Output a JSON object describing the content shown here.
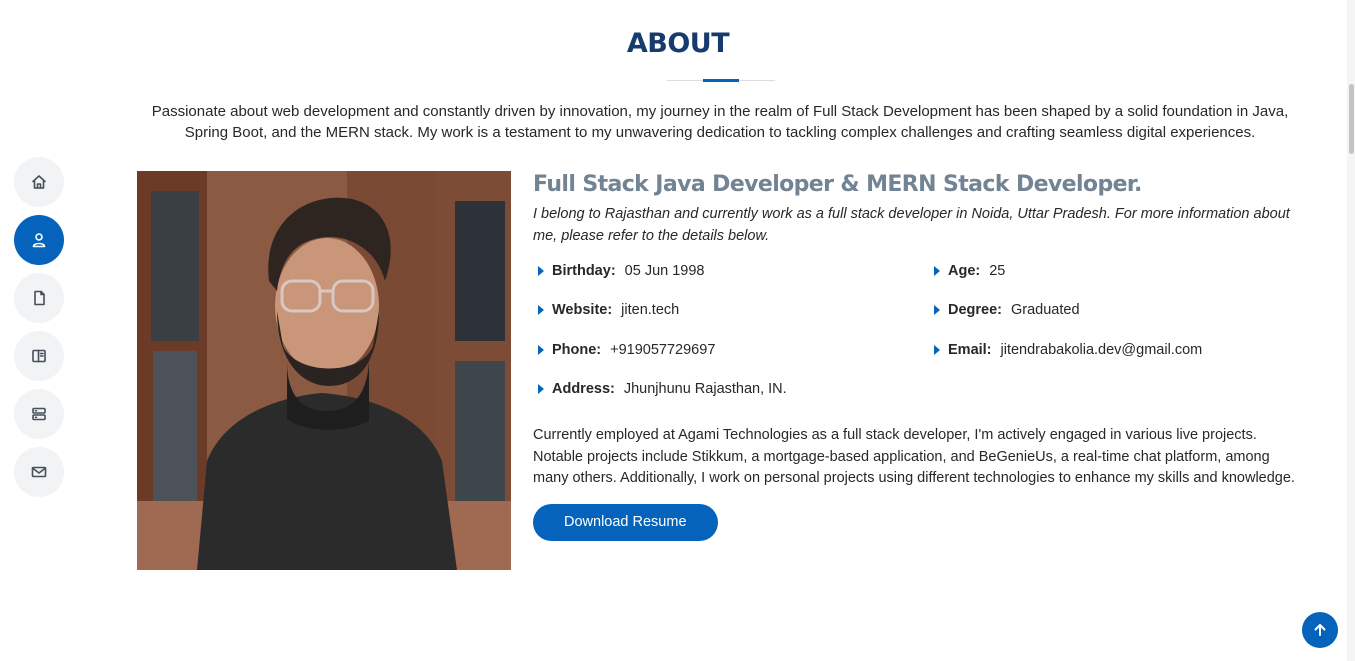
{
  "nav": {
    "items": [
      {
        "icon": "home-icon",
        "active": false
      },
      {
        "icon": "person-icon",
        "active": true
      },
      {
        "icon": "file-icon",
        "active": false
      },
      {
        "icon": "book-icon",
        "active": false
      },
      {
        "icon": "server-icon",
        "active": false
      },
      {
        "icon": "envelope-icon",
        "active": false
      }
    ]
  },
  "about": {
    "title": "ABOUT",
    "intro": "Passionate about web development and constantly driven by innovation, my journey in the realm of Full Stack Development has been shaped by a solid foundation in Java, Spring Boot, and the MERN stack. My work is a testament to my unwavering dedication to tackling complex challenges and crafting seamless digital experiences.",
    "role": "Full Stack Java Developer & MERN Stack Developer.",
    "lead": "I belong to Rajasthan and currently work as a full stack developer in Noida, Uttar Pradesh. For more information about me, please refer to the details below.",
    "details": {
      "birthday": {
        "label": "Birthday:",
        "value": "05 Jun 1998"
      },
      "age": {
        "label": "Age:",
        "value": "25"
      },
      "website": {
        "label": "Website:",
        "value": "jiten.tech"
      },
      "degree": {
        "label": "Degree:",
        "value": "Graduated"
      },
      "phone": {
        "label": "Phone:",
        "value": "+919057729697"
      },
      "email": {
        "label": "Email:",
        "value": "jitendrabakolia.dev@gmail.com"
      },
      "address": {
        "label": "Address:",
        "value": "Jhunjhunu Rajasthan, IN."
      }
    },
    "paragraph": "Currently employed at Agami Technologies as a full stack developer, I'm actively engaged in various live projects. Notable projects include Stikkum, a mortgage-based application, and BeGenieUs, a real-time chat platform, among many others. Additionally, I work on personal projects using different technologies to enhance my skills and knowledge.",
    "download_label": "Download Resume"
  },
  "colors": {
    "accent": "#0563bb",
    "title": "#173b6c",
    "subtitle": "#728394"
  },
  "back_to_top_icon": "arrow-up-icon"
}
